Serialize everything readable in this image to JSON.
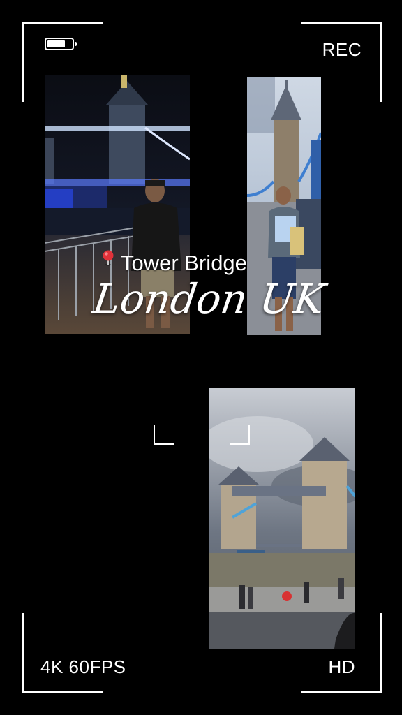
{
  "hud": {
    "rec_label": "REC",
    "resolution_label": "4K 60FPS",
    "quality_label": "HD",
    "battery_level": 0.75
  },
  "caption": {
    "place": "Tower Bridge",
    "city": "London UK",
    "pin_icon": "location-pin-icon"
  },
  "photos": [
    {
      "scene": "night",
      "subject": "tower-bridge"
    },
    {
      "scene": "day",
      "subject": "tower-bridge"
    },
    {
      "scene": "overcast",
      "subject": "tower-bridge"
    }
  ],
  "colors": {
    "background": "#000000",
    "hud": "#ffffff",
    "pin": "#e0323a"
  }
}
